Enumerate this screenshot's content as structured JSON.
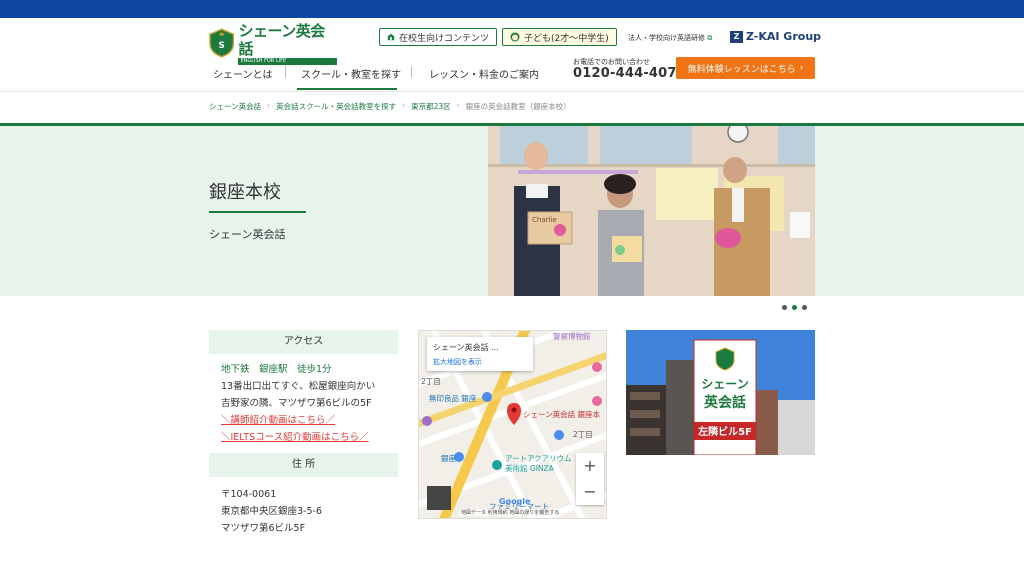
{
  "brand": {
    "name": "シェーン英会話",
    "tagline": "ENGLISH FOR LIFE"
  },
  "header": {
    "student_link": "在校生向けコンテンツ",
    "kids_link": "子ども(2才〜中学生)",
    "corporate_link": "法人・学校向け英語研修",
    "group": "Z-KAI Group",
    "group_mark": "Z",
    "phone_label": "お電話でのお問い合わせ",
    "phone": "0120-444-407",
    "cta": "無料体験レッスンはこちら"
  },
  "nav": {
    "items": [
      {
        "label": "シェーンとは"
      },
      {
        "label": "スクール・教室を探す"
      },
      {
        "label": "レッスン・料金のご案内"
      }
    ]
  },
  "breadcrumb": {
    "items": [
      "シェーン英会話",
      "英会話スクール・英会話教室を探す",
      "東京都23区"
    ],
    "current": "銀座の英会話教室（銀座本校）"
  },
  "hero": {
    "title": "銀座本校",
    "subtitle": "シェーン英会話",
    "photo_sign": "Charlie",
    "dots": 3,
    "active_dot": 1
  },
  "access": {
    "heading": "アクセス",
    "line1": "地下鉄　銀座駅　徒歩1分",
    "line2": "13番出口出てすぐ、松屋銀座向かい",
    "line3": "吉野家の隣、マツザワ第6ビルの5F",
    "video_link": "＼講師紹介動画はこちら／",
    "ielts_link": "＼IELTSコース紹介動画はこちら／"
  },
  "address": {
    "heading": "住 所",
    "zip": "〒104-0061",
    "line1": "東京都中央区銀座3-5-6",
    "line2": "マツザワ第6ビル5F"
  },
  "map": {
    "card_title": "シェーン英会話 ...",
    "card_link": "拡大地図を表示",
    "pin_label": "シェーン英会話 銀座本",
    "poi1": "無印良品 銀座",
    "poi2": "アートアクアリウム",
    "poi3": "美術館 GINZA",
    "poi4": "警察博物館",
    "area1": "2丁目",
    "area2": "2丁目",
    "station": "銀座",
    "poi5": "ファミリーマート",
    "zoom_in": "+",
    "zoom_out": "−",
    "google": "Google",
    "footer1": "地図データ",
    "footer2": "利用規約",
    "footer3": "地図の誤りを報告する"
  },
  "building_sign": {
    "line1": "シェーン",
    "line2": "英会話",
    "floor": "左隣ビル5F"
  },
  "colors": {
    "brand_green": "#1b7a3e",
    "top_blue": "#0d47a1",
    "cta_orange": "#f07414",
    "hero_bg": "#e7f4ec",
    "link_red": "#e53935"
  }
}
